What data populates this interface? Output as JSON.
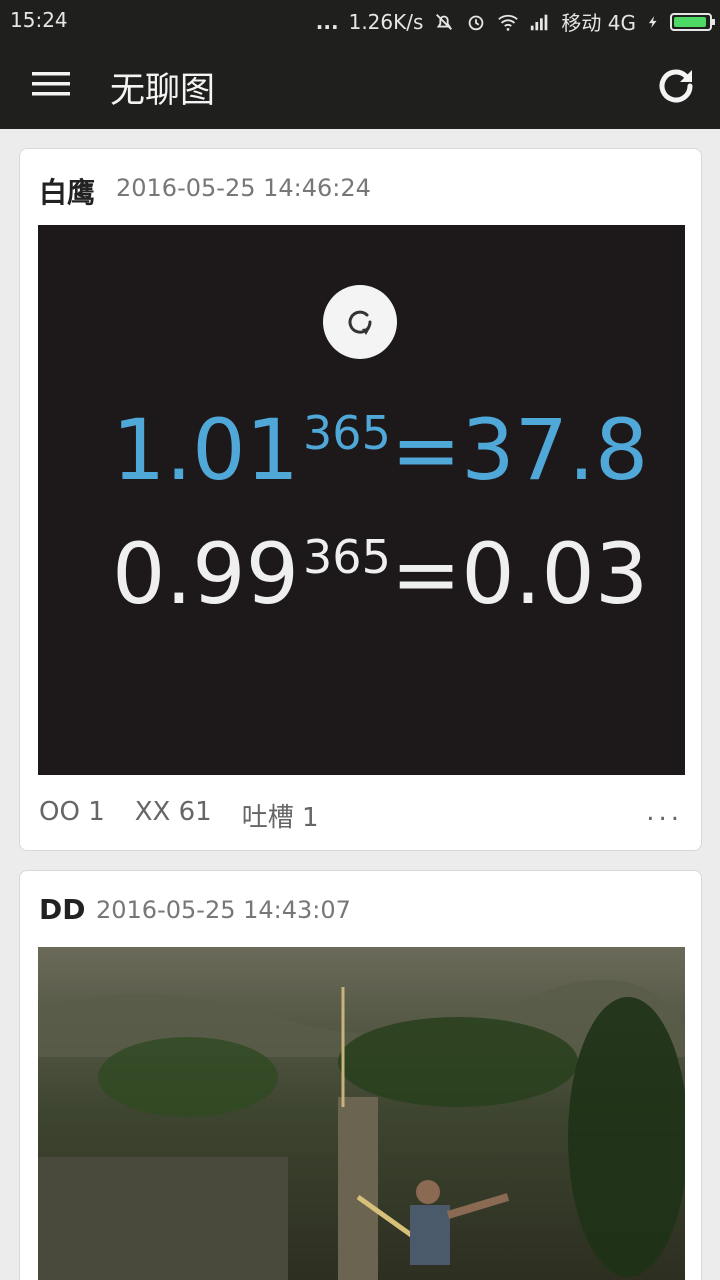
{
  "status_bar": {
    "time": "15:24",
    "dots": "...",
    "network_speed": "1.26K/s",
    "carrier": "移动 4G",
    "battery_level": 0.95
  },
  "app_bar": {
    "title": "无聊图"
  },
  "posts": [
    {
      "author": "白鹰",
      "date": "2016-05-25 14:46:24",
      "image_text": {
        "line1_base": "1.01",
        "line1_exp": "365",
        "line1_result": "=37.8",
        "line2_base": "0.99",
        "line2_exp": "365",
        "line2_result": "=0.03"
      },
      "oo": "OO 1",
      "xx": "XX 61",
      "comments": "吐槽 1",
      "more": "..."
    },
    {
      "author": "DD",
      "date": "2016-05-25 14:43:07"
    }
  ],
  "colors": {
    "app_bar_bg": "#1f1f1d",
    "formula_blue": "#4fa8d8",
    "image_bg": "#1d1819"
  }
}
